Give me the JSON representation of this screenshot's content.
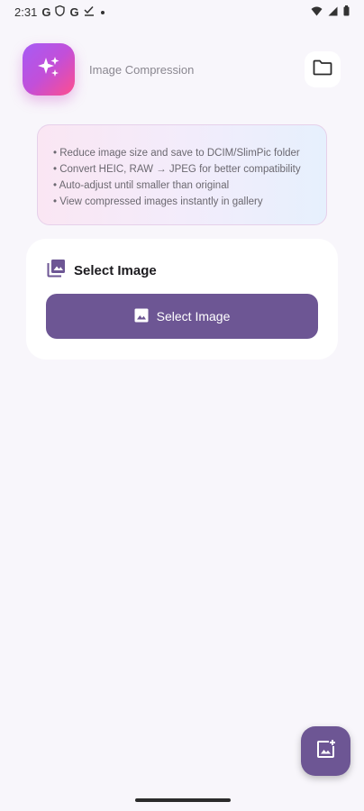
{
  "status_bar": {
    "time": "2:31",
    "notification_icons": [
      "google-g-icon",
      "shield-icon",
      "google-g-icon",
      "check-list-icon",
      "dot-icon"
    ],
    "system_icons": [
      "wifi-icon",
      "signal-icon",
      "battery-icon"
    ]
  },
  "header": {
    "app_icon": "sparkles-icon",
    "title": "Image Compression",
    "folder_icon": "folder-icon"
  },
  "info": {
    "lines": [
      "• Reduce image size and save to DCIM/SlimPic folder",
      "• Convert HEIC, RAW → JPEG for better compatibility",
      "• Auto-adjust until smaller than original",
      "• View compressed images instantly in gallery"
    ]
  },
  "select_section": {
    "icon": "photo-library-icon",
    "title": "Select Image",
    "button_icon": "image-icon",
    "button_label": "Select Image"
  },
  "fab": {
    "icon": "add-photo-icon"
  },
  "colors": {
    "primary": "#6d5694",
    "background": "#f8f6fb",
    "app_icon_gradient_start": "#a65cf5",
    "app_icon_gradient_end": "#ff4d8d"
  }
}
